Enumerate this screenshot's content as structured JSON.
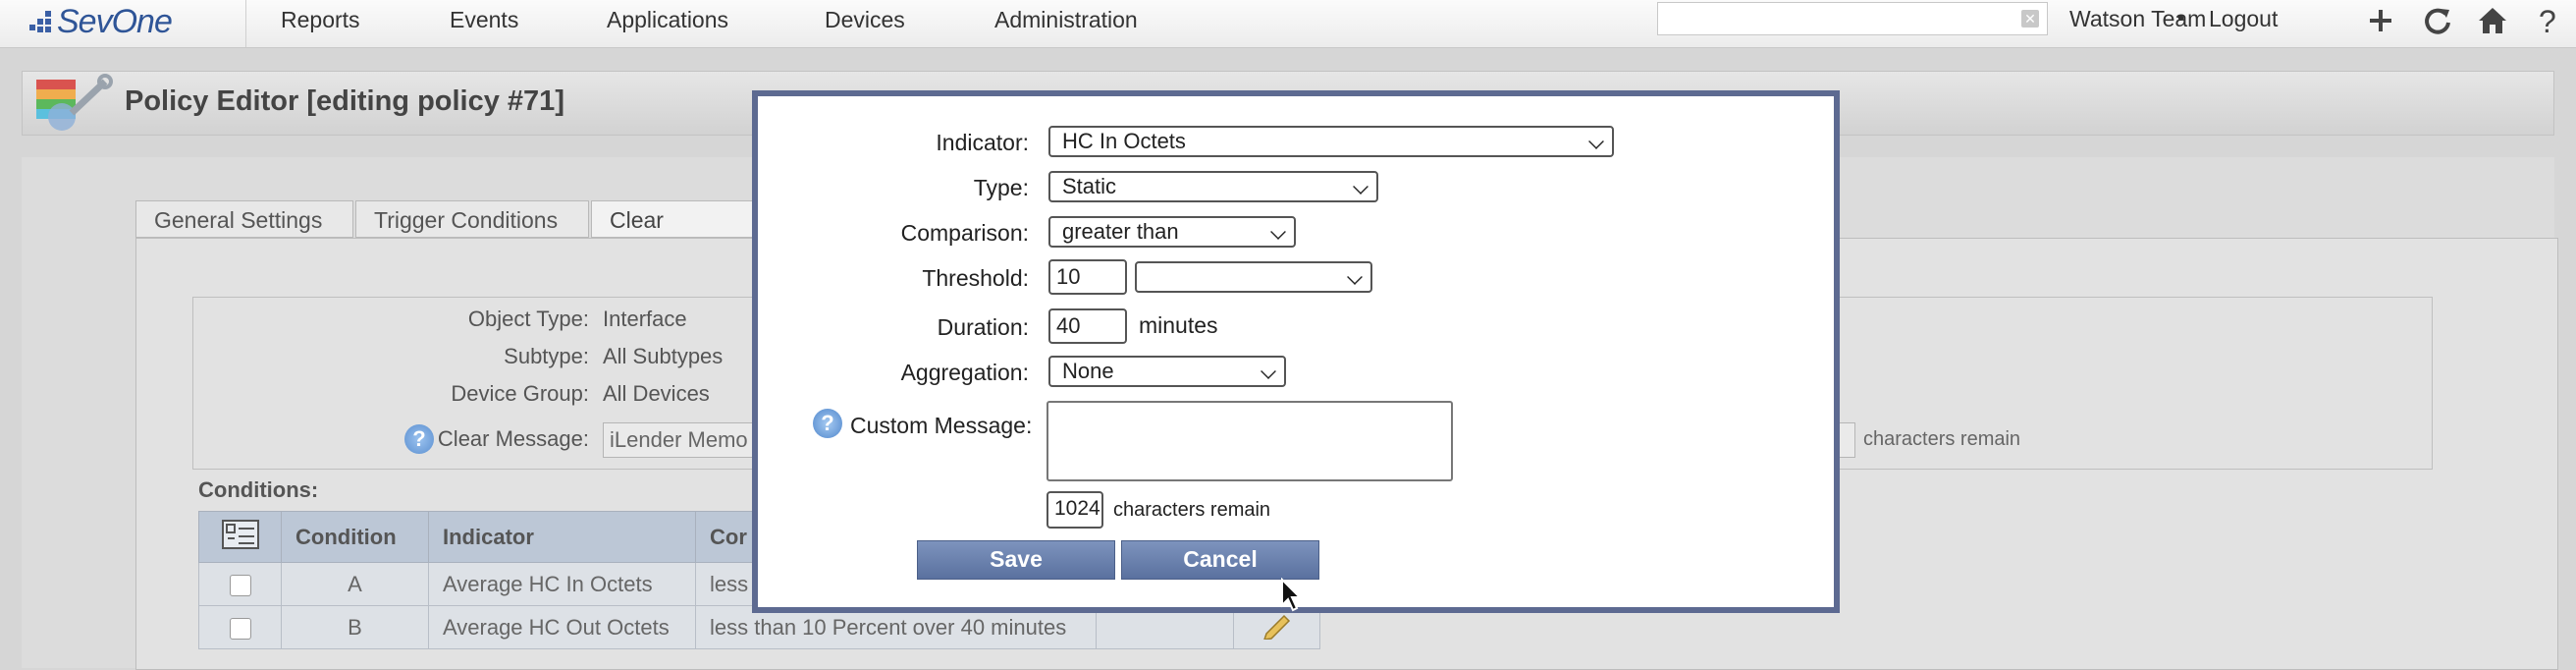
{
  "nav": {
    "logo": "SevOne",
    "items": [
      "Reports",
      "Events",
      "Applications",
      "Devices",
      "Administration"
    ],
    "search_value": "",
    "user": "Watson Team",
    "separator": "•",
    "logout": "Logout",
    "icons": [
      "plus-icon",
      "refresh-icon",
      "home-icon",
      "help-icon"
    ]
  },
  "page": {
    "title": "Policy Editor [editing policy #71]",
    "tabs": [
      "General Settings",
      "Trigger Conditions",
      "Clear Conditi"
    ],
    "info": {
      "object_type_label": "Object Type:",
      "object_type": "Interface",
      "subtype_label": "Subtype:",
      "subtype": "All Subtypes",
      "device_group_label": "Device Group:",
      "device_group": "All Devices",
      "clear_message_label": "Clear Message:",
      "clear_message": "iLender Memo",
      "chars_remain": "characters remain"
    },
    "conditions_label": "Conditions:",
    "table": {
      "headers": [
        "",
        "Condition",
        "Indicator",
        "Cor"
      ],
      "rows": [
        {
          "condition": "A",
          "indicator": "Average HC In Octets",
          "comparison": "less"
        },
        {
          "condition": "B",
          "indicator": "Average HC Out Octets",
          "comparison": "less than 10 Percent over 40 minutes"
        }
      ]
    }
  },
  "modal": {
    "indicator_label": "Indicator:",
    "indicator_value": "HC In Octets",
    "type_label": "Type:",
    "type_value": "Static",
    "comparison_label": "Comparison:",
    "comparison_value": "greater than",
    "threshold_label": "Threshold:",
    "threshold_value": "10",
    "threshold_unit": "",
    "duration_label": "Duration:",
    "duration_value": "40",
    "duration_unit": "minutes",
    "aggregation_label": "Aggregation:",
    "aggregation_value": "None",
    "custom_message_label": "Custom Message:",
    "custom_message_value": "",
    "chars_count": "1024",
    "chars_remain": "characters remain",
    "save_label": "Save",
    "cancel_label": "Cancel"
  },
  "colors": {
    "brand": "#2f5597",
    "modal_border": "#5d6a91",
    "button": "#6a82b0",
    "table_header": "#bcc7d6"
  }
}
